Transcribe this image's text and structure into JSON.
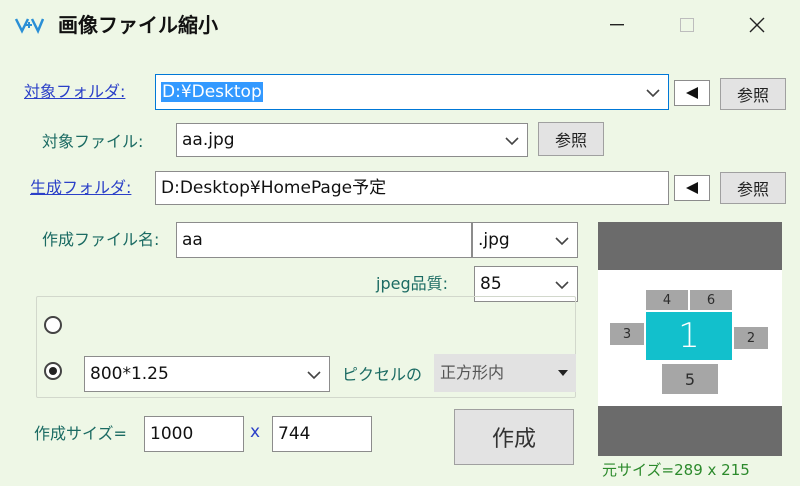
{
  "window": {
    "title": "画像ファイル縮小",
    "minimize_label": "—",
    "maximize_label": "☐",
    "close_label": "✕"
  },
  "colors": {
    "background": "#eef7e6",
    "label_teal": "#1b6b63",
    "link_blue": "#2b40c8",
    "selection": "#3399ff",
    "preview_accent": "#12c0cc"
  },
  "target_folder": {
    "label": "対象フォルダ:",
    "value": "D:¥Desktop",
    "back_button": "◀",
    "browse_button": "参照"
  },
  "target_file": {
    "label": "対象ファイル:",
    "value": "aa.jpg",
    "browse_button": "参照"
  },
  "output_folder": {
    "label": "生成フォルダ:",
    "value": "D:Desktop¥HomePage予定",
    "back_button": "◀",
    "browse_button": "参照"
  },
  "output_filename": {
    "label": "作成ファイル名:",
    "value": "aa",
    "extension": ".jpg"
  },
  "jpeg_quality": {
    "label": "jpeg品質:",
    "value": "85"
  },
  "size_options": {
    "option1_selected": false,
    "option2_selected": true,
    "size_value": "800*1.25",
    "pixel_label": "ピクセルの",
    "fit_mode": "正方形内"
  },
  "created_size": {
    "label": "作成サイズ=",
    "width": "1000",
    "times": "x",
    "height": "744"
  },
  "create_button": "作成",
  "preview": {
    "boxes": [
      "1",
      "2",
      "3",
      "4",
      "5",
      "6"
    ],
    "original_size": "元サイズ=289 x 215"
  }
}
